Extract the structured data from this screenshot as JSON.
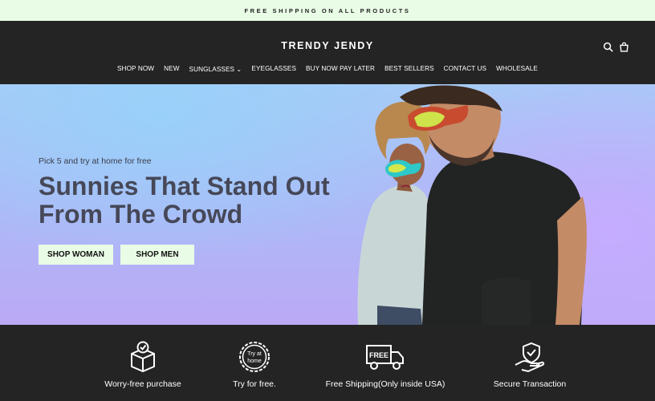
{
  "announcement": "FREE SHIPPING ON ALL PRODUCTS",
  "header": {
    "logo": "TRENDY JENDY",
    "icons": [
      "search-icon",
      "bag-icon"
    ]
  },
  "nav": [
    "SHOP NOW",
    "NEW",
    "SUNGLASSES ⌄",
    "EYEGLASSES",
    "BUY NOW PAY LATER",
    "BEST SELLERS",
    "CONTACT US",
    "WHOLESALE"
  ],
  "hero": {
    "kicker": "Pick 5 and try at home for free",
    "title": "Sunnies That Stand Out From The Crowd",
    "buttons": [
      "SHOP WOMAN",
      "SHOP MEN"
    ]
  },
  "features": [
    {
      "label": "Worry-free purchase",
      "icon": "box-check-icon"
    },
    {
      "label": "Try for free.",
      "icon": "try-at-home-badge-icon",
      "badge_line1": "Try at",
      "badge_line2": "home"
    },
    {
      "label": "Free Shipping(Only inside USA)",
      "icon": "free-truck-icon",
      "truck_text": "FREE"
    },
    {
      "label": "Secure Transaction",
      "icon": "hand-shield-icon"
    }
  ],
  "colors": {
    "announcement_bg": "#e9fde6",
    "header_bg": "#242424",
    "button_bg": "#e9fde6",
    "hero_title": "#464858"
  }
}
